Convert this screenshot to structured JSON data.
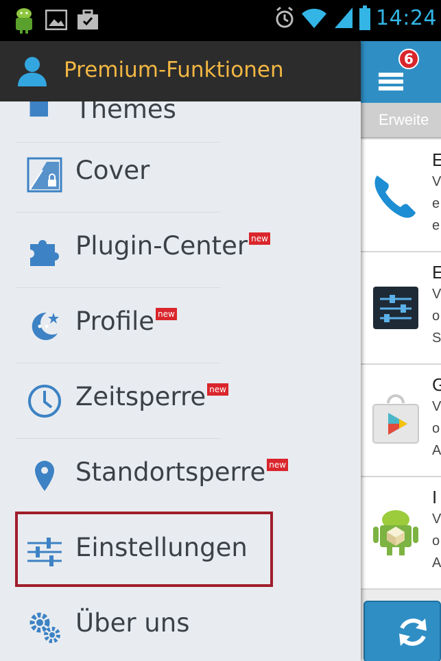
{
  "status_bar": {
    "time": "14:24",
    "icons": [
      "android-icon",
      "image-icon",
      "briefcase-icon",
      "alarm-icon",
      "wifi-icon",
      "signal-icon",
      "battery-icon"
    ]
  },
  "drawer": {
    "header_title": "Premium-Funktionen",
    "header_icon": "person-icon",
    "partial_item_label": "Themes",
    "items": [
      {
        "label": "Cover",
        "icon": "cover-icon",
        "badge": ""
      },
      {
        "label": "Plugin-Center",
        "icon": "puzzle-icon",
        "badge": "new"
      },
      {
        "label": "Profile",
        "icon": "moon-icon",
        "badge": "new"
      },
      {
        "label": "Zeitsperre",
        "icon": "clock-icon",
        "badge": "new"
      },
      {
        "label": "Standortsperre",
        "icon": "location-pin-icon",
        "badge": "new"
      },
      {
        "label": "Einstellungen",
        "icon": "sliders-icon",
        "badge": ""
      },
      {
        "label": "Über uns",
        "icon": "gears-icon",
        "badge": ""
      }
    ],
    "highlighted_item": "Einstellungen"
  },
  "right_panel": {
    "notification_count": "6",
    "section_header": "Erweite",
    "rows": [
      {
        "title": "E",
        "lines": [
          "V",
          "e",
          "e"
        ],
        "icon": "phone-icon"
      },
      {
        "title": "E",
        "lines": [
          "V",
          "o",
          "S"
        ],
        "icon": "settings-sliders-icon"
      },
      {
        "title": "G",
        "lines": [
          "V",
          "o",
          "A"
        ],
        "icon": "play-store-icon"
      },
      {
        "title": "I",
        "lines": [
          "V",
          "o",
          "A"
        ],
        "icon": "android-box-icon"
      }
    ]
  },
  "colors": {
    "accent_blue": "#2f8fc5",
    "header_title": "#f2b743",
    "badge_red": "#d9262c",
    "highlight_border": "#9f1d2a",
    "drawer_bg": "#e8ecf0"
  }
}
